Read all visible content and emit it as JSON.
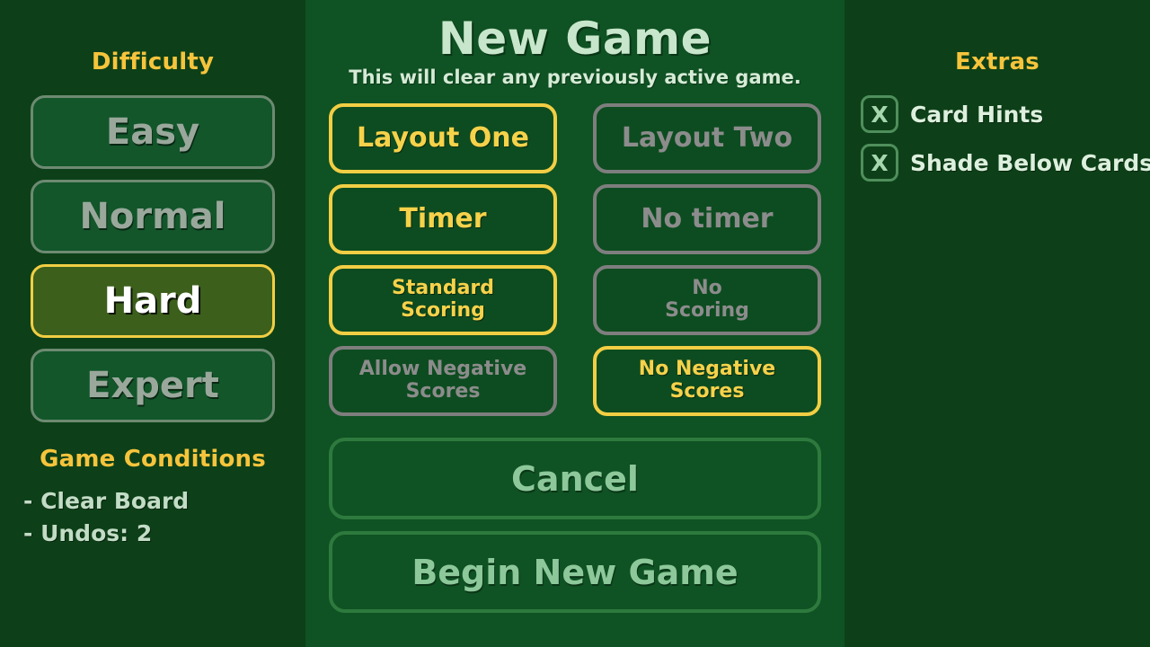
{
  "difficulty": {
    "heading": "Difficulty",
    "options": [
      {
        "label": "Easy",
        "selected": false
      },
      {
        "label": "Normal",
        "selected": false
      },
      {
        "label": "Hard",
        "selected": true
      },
      {
        "label": "Expert",
        "selected": false
      }
    ]
  },
  "game_conditions": {
    "heading": "Game Conditions",
    "items": [
      "- Clear Board",
      "- Undos: 2"
    ]
  },
  "center": {
    "title": "New Game",
    "subtitle": "This will clear any previously active game.",
    "toggles": [
      {
        "line1": "Layout One",
        "line2": "",
        "active": true,
        "multiline": false
      },
      {
        "line1": "Layout Two",
        "line2": "",
        "active": false,
        "multiline": false
      },
      {
        "line1": "Timer",
        "line2": "",
        "active": true,
        "multiline": false
      },
      {
        "line1": "No timer",
        "line2": "",
        "active": false,
        "multiline": false
      },
      {
        "line1": "Standard",
        "line2": "Scoring",
        "active": true,
        "multiline": true
      },
      {
        "line1": "No",
        "line2": "Scoring",
        "active": false,
        "multiline": true
      },
      {
        "line1": "Allow Negative",
        "line2": "Scores",
        "active": false,
        "multiline": true
      },
      {
        "line1": "No Negative",
        "line2": "Scores",
        "active": true,
        "multiline": true
      }
    ],
    "actions": [
      {
        "label": "Cancel"
      },
      {
        "label": "Begin New Game"
      }
    ]
  },
  "extras": {
    "heading": "Extras",
    "items": [
      {
        "mark": "X",
        "label": "Card Hints",
        "checked": true
      },
      {
        "mark": "X",
        "label": "Shade Below Cards",
        "checked": true
      }
    ]
  },
  "colors": {
    "panel_side_bg": "#0d4018",
    "panel_center_bg": "#0f5223",
    "accent_gold": "#f2ce44",
    "accent_gold_text": "#f6d24a",
    "heading_gold": "#f6c43c",
    "inactive_gray": "#8c8c8c",
    "selected_fill": "#3c5f1c",
    "action_text": "#8dc89a",
    "title_text": "#c8e6cb"
  }
}
